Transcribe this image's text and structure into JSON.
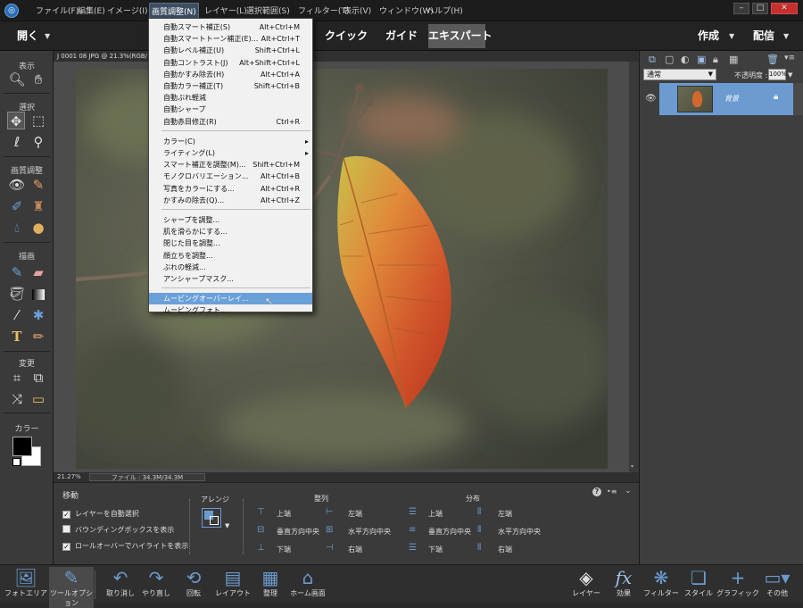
{
  "menubar": {
    "items": [
      "ファイル(F)",
      "編集(E)",
      "イメージ(I)",
      "画質調整(N)",
      "レイヤー(L)",
      "選択範囲(S)",
      "フィルター(T)",
      "表示(V)",
      "ウィンドウ(W)",
      "ヘルプ(H)"
    ],
    "active_index": 3,
    "window_buttons": [
      "–",
      "□",
      "✕"
    ]
  },
  "modebar": {
    "open_label": "開く",
    "tabs": [
      "クイック",
      "ガイド",
      "エキスパート"
    ],
    "selected_tab": "エキスパート",
    "create_label": "作成",
    "share_label": "配信"
  },
  "toolbox": {
    "sections": [
      "表示",
      "選択",
      "画質調整",
      "描画",
      "変更",
      "カラー"
    ]
  },
  "document": {
    "tab_title": "J 0001 08 JPG @ 21.3%(RGB/"
  },
  "status": {
    "zoom": "21.27%",
    "file_info": "ファイル : 34.3M/34.3M"
  },
  "options": {
    "tool_name": "移動",
    "checkboxes": [
      {
        "label": "レイヤーを自動選択",
        "checked": true
      },
      {
        "label": "バウンディングボックスを表示",
        "checked": false
      },
      {
        "label": "ロールオーバーでハイライトを表示",
        "checked": true
      }
    ],
    "arrange_label": "アレンジ",
    "align_label": "整列",
    "distribute_label": "分布",
    "align_items": [
      "上端",
      "左端",
      "垂直方向中央",
      "水平方向中央",
      "下端",
      "右端"
    ],
    "distribute_items": [
      "上端",
      "左端",
      "垂直方向中央",
      "水平方向中央",
      "下端",
      "右端"
    ]
  },
  "layers": {
    "blend_mode": "通常",
    "opacity_label": "不透明度 :",
    "opacity_value": "100%",
    "layer_name": "背景"
  },
  "bottombar": {
    "left": [
      "フォトエリア",
      "ツールオプション",
      "取り消し",
      "やり直し",
      "回転",
      "レイアウト",
      "整理",
      "ホーム画面"
    ],
    "right": [
      "レイヤー",
      "効果",
      "フィルター",
      "スタイル",
      "グラフィック",
      "その他"
    ]
  },
  "dropdown": {
    "groups": [
      [
        {
          "label": "自動スマート補正(S)",
          "shortcut": "Alt+Ctrl+M"
        },
        {
          "label": "自動スマートトーン補正(E)...",
          "shortcut": "Alt+Ctrl+T"
        },
        {
          "label": "自動レベル補正(U)",
          "shortcut": "Shift+Ctrl+L"
        },
        {
          "label": "自動コントラスト(J)",
          "shortcut": "Alt+Shift+Ctrl+L"
        },
        {
          "label": "自動かすみ除去(H)",
          "shortcut": "Alt+Ctrl+A"
        },
        {
          "label": "自動カラー補正(T)",
          "shortcut": "Shift+Ctrl+B"
        },
        {
          "label": "自動ぶれ軽減",
          "shortcut": ""
        },
        {
          "label": "自動シャープ",
          "shortcut": ""
        },
        {
          "label": "自動赤目修正(R)",
          "shortcut": "Ctrl+R"
        }
      ],
      [
        {
          "label": "カラー(C)",
          "shortcut": "",
          "submenu": true
        },
        {
          "label": "ライティング(L)",
          "shortcut": "",
          "submenu": true
        },
        {
          "label": "スマート補正を調整(M)...",
          "shortcut": "Shift+Ctrl+M"
        },
        {
          "label": "モノクロバリエーション...",
          "shortcut": "Alt+Ctrl+B"
        },
        {
          "label": "写真をカラーにする...",
          "shortcut": "Alt+Ctrl+R"
        },
        {
          "label": "かすみの除去(Q)...",
          "shortcut": "Alt+Ctrl+Z"
        }
      ],
      [
        {
          "label": "シャープを調整...",
          "shortcut": ""
        },
        {
          "label": "肌を滑らかにする...",
          "shortcut": ""
        },
        {
          "label": "閉じた目を調整...",
          "shortcut": ""
        },
        {
          "label": "顔立ちを調整...",
          "shortcut": ""
        },
        {
          "label": "ぶれの軽減...",
          "shortcut": ""
        },
        {
          "label": "アンシャープマスク...",
          "shortcut": ""
        }
      ],
      [
        {
          "label": "ムービングオーバーレイ...",
          "shortcut": "",
          "highlighted": true
        },
        {
          "label": "ムービングフォト...",
          "shortcut": ""
        }
      ]
    ]
  }
}
